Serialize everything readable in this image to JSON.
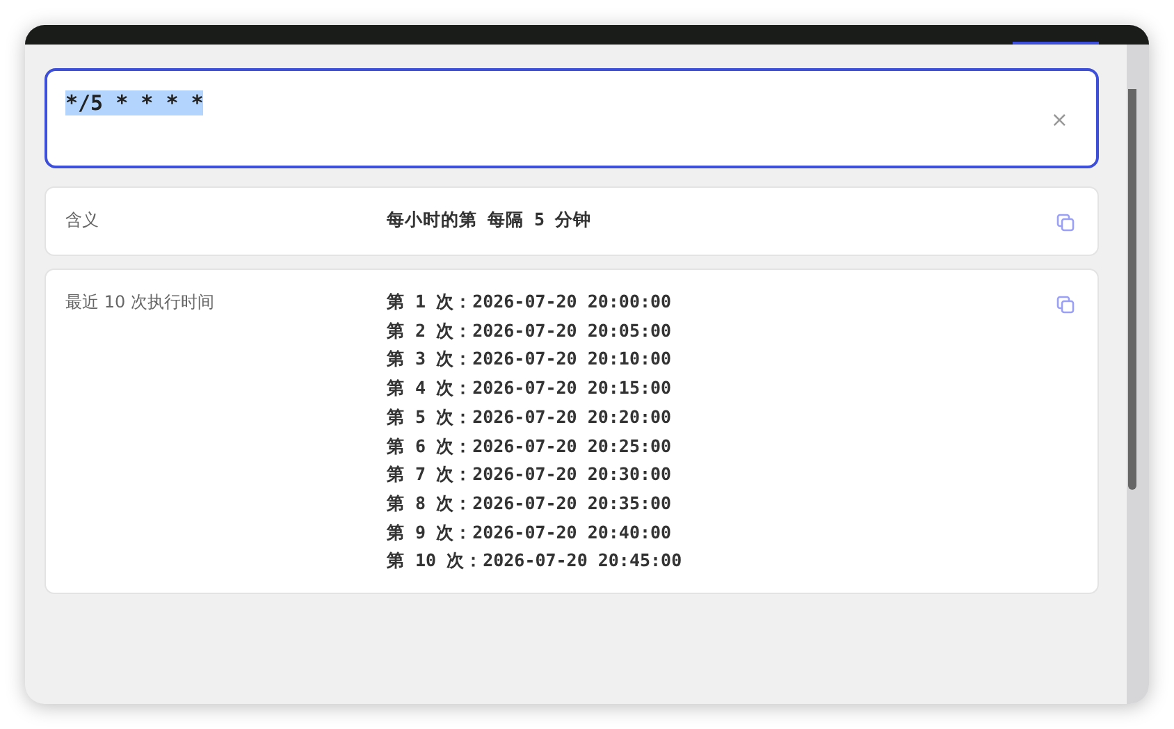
{
  "expression": {
    "value": "*/5 * * * *",
    "selected": true,
    "clear": "×"
  },
  "rows": [
    {
      "label": "含义",
      "lines": [
        "每小时的第 每隔 5 分钟"
      ]
    },
    {
      "label": "最近 10 次执行时间",
      "lines": [
        "第 1 次：2026-07-20 20:00:00",
        "第 2 次：2026-07-20 20:05:00",
        "第 3 次：2026-07-20 20:10:00",
        "第 4 次：2026-07-20 20:15:00",
        "第 5 次：2026-07-20 20:20:00",
        "第 6 次：2026-07-20 20:25:00",
        "第 7 次：2026-07-20 20:30:00",
        "第 8 次：2026-07-20 20:35:00",
        "第 9 次：2026-07-20 20:40:00",
        "第 10 次：2026-07-20 20:45:00"
      ]
    }
  ]
}
